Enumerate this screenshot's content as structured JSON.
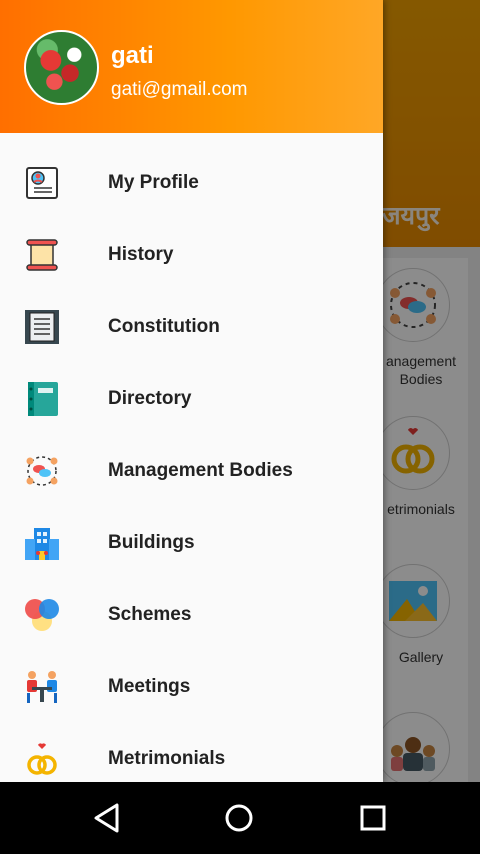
{
  "background": {
    "header_text": "जयपुर",
    "tiles": [
      {
        "label": "anagement\nBodies"
      },
      {
        "label": "etrimonials"
      },
      {
        "label": "Gallery"
      }
    ]
  },
  "drawer": {
    "user": {
      "name": "gati",
      "email": "gati@gmail.com"
    },
    "items": [
      {
        "label": "My Profile",
        "icon": "profile-icon"
      },
      {
        "label": "History",
        "icon": "scroll-icon"
      },
      {
        "label": "Constitution",
        "icon": "document-icon"
      },
      {
        "label": "Directory",
        "icon": "book-icon"
      },
      {
        "label": "Management Bodies",
        "icon": "people-chat-icon"
      },
      {
        "label": "Buildings",
        "icon": "buildings-icon"
      },
      {
        "label": "Schemes",
        "icon": "circles-icon"
      },
      {
        "label": "Meetings",
        "icon": "meeting-icon"
      },
      {
        "label": "Metrimonials",
        "icon": "rings-icon"
      }
    ]
  },
  "navbar": {
    "buttons": [
      "back",
      "home",
      "recents"
    ]
  },
  "colors": {
    "accent": "#ff8f00",
    "header_start": "#ff6f00",
    "header_end": "#ffa726"
  }
}
